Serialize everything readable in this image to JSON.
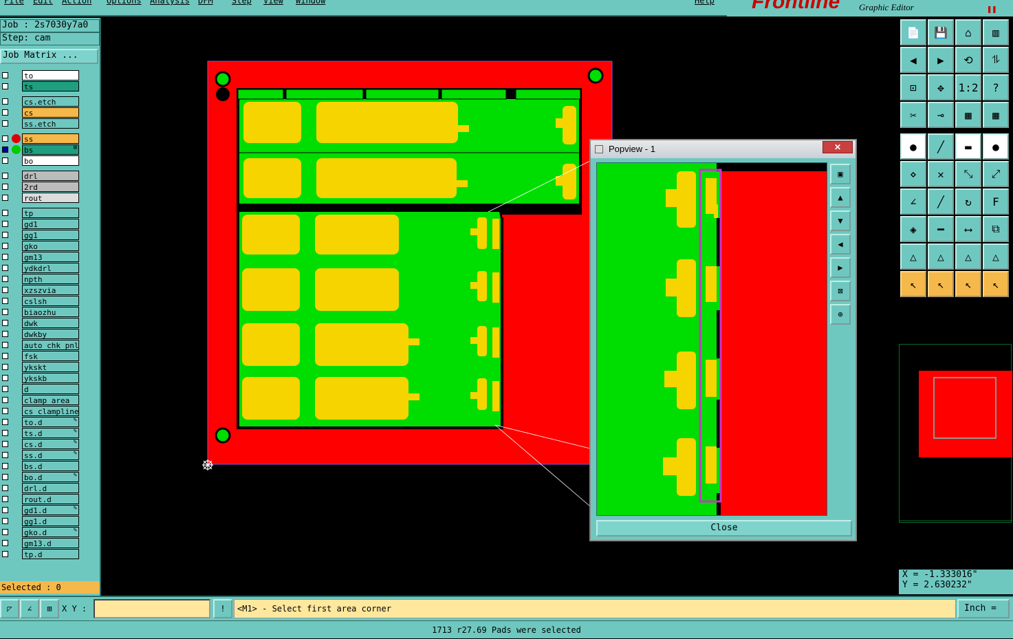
{
  "menu": {
    "items": [
      "File",
      "Edit",
      "Action",
      "Options",
      "Analysis",
      "DFM",
      "Step",
      "View",
      "Window",
      "Help"
    ]
  },
  "brand": {
    "logo": "Frontline",
    "subtitle": "Graphic Editor"
  },
  "job": {
    "job_label": "Job : 2s7030y7a0",
    "step_label": "Step: cam",
    "matrix_button": "Job Matrix ..."
  },
  "layers": [
    {
      "name": "to",
      "color": "#ffffff",
      "dot": ""
    },
    {
      "name": "ts",
      "color": "#1f9f7f",
      "dot": ""
    },
    {
      "name": "cs.etch",
      "color": "#6fc8c0",
      "dot": ""
    },
    {
      "name": "cs",
      "color": "#f5b84a",
      "dot": ""
    },
    {
      "name": "ss.etch",
      "color": "#6fc8c0",
      "dot": ""
    },
    {
      "name": "ss",
      "color": "#f5b84a",
      "dot": "#e00000"
    },
    {
      "name": "bs",
      "color": "#1f9f7f",
      "dot": "#00cc00",
      "flag": "⊞"
    },
    {
      "name": "bo",
      "color": "#ffffff",
      "dot": ""
    },
    {
      "name": "drl",
      "color": "#bcbcbc",
      "dot": ""
    },
    {
      "name": "2rd",
      "color": "#bcbcbc",
      "dot": ""
    },
    {
      "name": "rout",
      "color": "#dcdcdc",
      "dot": ""
    },
    {
      "name": "tp",
      "color": "#6fc8c0",
      "dot": ""
    },
    {
      "name": "gd1",
      "color": "#6fc8c0",
      "dot": ""
    },
    {
      "name": "gg1",
      "color": "#6fc8c0",
      "dot": ""
    },
    {
      "name": "gko",
      "color": "#6fc8c0",
      "dot": ""
    },
    {
      "name": "gm13",
      "color": "#6fc8c0",
      "dot": ""
    },
    {
      "name": "ydkdrl",
      "color": "#6fc8c0",
      "dot": ""
    },
    {
      "name": "npth",
      "color": "#6fc8c0",
      "dot": ""
    },
    {
      "name": "xzszvia",
      "color": "#6fc8c0",
      "dot": ""
    },
    {
      "name": "cslsh",
      "color": "#6fc8c0",
      "dot": ""
    },
    {
      "name": "biaozhu",
      "color": "#6fc8c0",
      "dot": ""
    },
    {
      "name": "dwk",
      "color": "#6fc8c0",
      "dot": ""
    },
    {
      "name": "dwkby",
      "color": "#6fc8c0",
      "dot": ""
    },
    {
      "name": "auto_chk_pnl",
      "color": "#6fc8c0",
      "dot": ""
    },
    {
      "name": "fsk",
      "color": "#6fc8c0",
      "dot": ""
    },
    {
      "name": "ykskt",
      "color": "#6fc8c0",
      "dot": ""
    },
    {
      "name": "ykskb",
      "color": "#6fc8c0",
      "dot": ""
    },
    {
      "name": "d",
      "color": "#6fc8c0",
      "dot": ""
    },
    {
      "name": "clamp_area",
      "color": "#6fc8c0",
      "dot": ""
    },
    {
      "name": "cs_clampline",
      "color": "#6fc8c0",
      "dot": ""
    },
    {
      "name": "to.d",
      "color": "#6fc8c0",
      "dot": "",
      "flag": "✎"
    },
    {
      "name": "ts.d",
      "color": "#6fc8c0",
      "dot": "",
      "flag": "✎"
    },
    {
      "name": "cs.d",
      "color": "#6fc8c0",
      "dot": "",
      "flag": "✎"
    },
    {
      "name": "ss.d",
      "color": "#6fc8c0",
      "dot": "",
      "flag": "✎"
    },
    {
      "name": "bs.d",
      "color": "#6fc8c0",
      "dot": ""
    },
    {
      "name": "bo.d",
      "color": "#6fc8c0",
      "dot": "",
      "flag": "✎"
    },
    {
      "name": "drl.d",
      "color": "#6fc8c0",
      "dot": ""
    },
    {
      "name": "rout.d",
      "color": "#6fc8c0",
      "dot": ""
    },
    {
      "name": "gd1.d",
      "color": "#6fc8c0",
      "dot": "",
      "flag": "✎"
    },
    {
      "name": "gg1.d",
      "color": "#6fc8c0",
      "dot": ""
    },
    {
      "name": "gko.d",
      "color": "#6fc8c0",
      "dot": "",
      "flag": "✎"
    },
    {
      "name": "gm13.d",
      "color": "#6fc8c0",
      "dot": ""
    },
    {
      "name": "tp.d",
      "color": "#6fc8c0",
      "dot": ""
    }
  ],
  "selected": "Selected : 0",
  "popview": {
    "title": "Popview - 1",
    "close_label": "Close"
  },
  "coords": {
    "x": "X = -1.333016\"",
    "y": "Y = 2.630232\""
  },
  "bottom": {
    "xy_label": "X Y :",
    "xy_value": "",
    "prompt": "<M1> - Select first area corner",
    "units": "Inch ="
  },
  "status": "1713 r27.69 Pads were selected",
  "colors": {
    "ui": "#6fc8c0",
    "board_red": "#ff0000",
    "copper_green": "#00dd00",
    "pad_yellow": "#f5d400",
    "highlight": "#cc33cc"
  }
}
